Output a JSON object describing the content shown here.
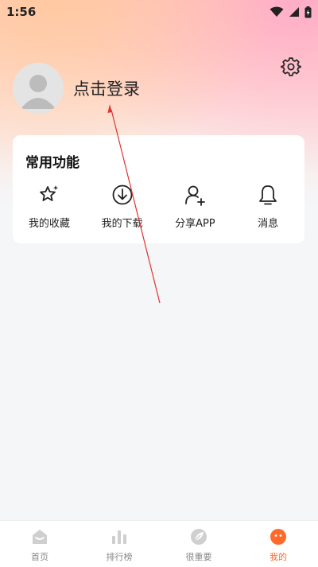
{
  "status_bar": {
    "time": "1:56",
    "icons": [
      "wifi-icon",
      "cellular-signal-icon",
      "battery-icon"
    ]
  },
  "header": {
    "settings_icon": "gear-icon",
    "login_text": "点击登录",
    "avatar_icon": "default-user-avatar"
  },
  "common_functions": {
    "title": "常用功能",
    "items": [
      {
        "label": "我的收藏",
        "icon": "star-sparkle-icon"
      },
      {
        "label": "我的下载",
        "icon": "download-circle-icon"
      },
      {
        "label": "分享APP",
        "icon": "add-user-icon"
      },
      {
        "label": "消息",
        "icon": "bell-icon"
      }
    ]
  },
  "bottom_nav": {
    "items": [
      {
        "label": "首页",
        "icon": "home-icon",
        "active": false
      },
      {
        "label": "排行榜",
        "icon": "bar-chart-icon",
        "active": false
      },
      {
        "label": "很重要",
        "icon": "leaf-icon",
        "active": false
      },
      {
        "label": "我的",
        "icon": "profile-face-icon",
        "active": true
      }
    ]
  },
  "colors": {
    "accent": "#ff6a2b",
    "background": "#f5f6f8",
    "annotation": "#e3312f"
  }
}
